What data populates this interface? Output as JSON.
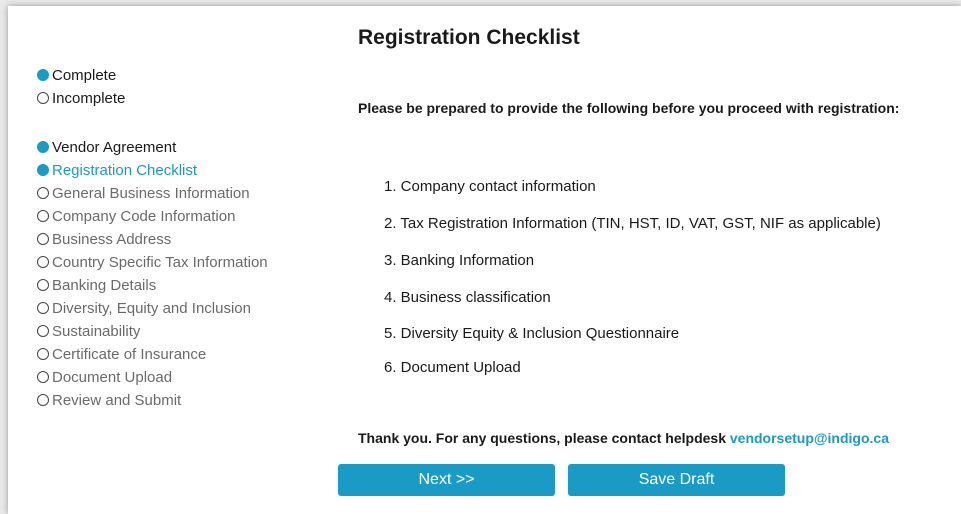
{
  "legend": {
    "complete": "Complete",
    "incomplete": "Incomplete"
  },
  "steps": [
    {
      "label": "Vendor Agreement",
      "status": "complete"
    },
    {
      "label": "Registration Checklist",
      "status": "current"
    },
    {
      "label": "General Business Information",
      "status": "incomplete"
    },
    {
      "label": "Company Code Information",
      "status": "incomplete"
    },
    {
      "label": "Business Address",
      "status": "incomplete"
    },
    {
      "label": "Country Specific Tax Information",
      "status": "incomplete"
    },
    {
      "label": "Banking Details",
      "status": "incomplete"
    },
    {
      "label": "Diversity, Equity and Inclusion",
      "status": "incomplete"
    },
    {
      "label": "Sustainability",
      "status": "incomplete"
    },
    {
      "label": "Certificate of Insurance",
      "status": "incomplete"
    },
    {
      "label": "Document Upload",
      "status": "incomplete"
    },
    {
      "label": "Review and Submit",
      "status": "incomplete"
    }
  ],
  "main": {
    "title": "Registration Checklist",
    "intro": "Please be prepared to provide the following before you proceed with registration:",
    "items": [
      "1. Company contact information",
      "2. Tax Registration Information (TIN, HST, ID, VAT, GST, NIF as applicable)",
      "3. Banking Information",
      "4. Business classification",
      "5. Diversity Equity & Inclusion Questionnaire",
      "6. Document Upload"
    ],
    "thanks": "Thank you. For any questions, please contact helpdesk",
    "email": "vendorsetup@indigo.ca"
  },
  "buttons": {
    "next": "Next >>",
    "save_draft": "Save Draft"
  },
  "colors": {
    "accent": "#1a9bc6"
  }
}
